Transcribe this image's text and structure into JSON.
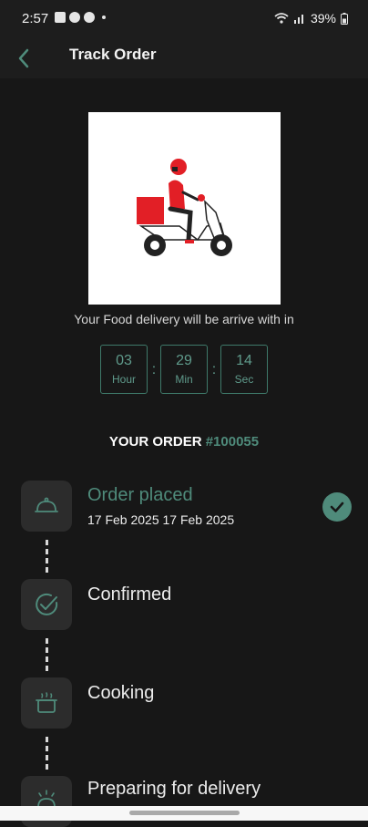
{
  "status_bar": {
    "time": "2:57",
    "battery": "39%"
  },
  "app_bar": {
    "title": "Track Order"
  },
  "delivery": {
    "message": "Your Food delivery will be arrive with in"
  },
  "countdown": [
    {
      "value": "03",
      "label": "Hour"
    },
    {
      "value": "29",
      "label": "Min"
    },
    {
      "value": "14",
      "label": "Sec"
    }
  ],
  "order": {
    "label": "YOUR ORDER",
    "id": "#100055"
  },
  "steps": [
    {
      "title": "Order placed",
      "date": "17 Feb 2025 17 Feb 2025",
      "done": true,
      "icon": "cloche-icon"
    },
    {
      "title": "Confirmed",
      "date": "",
      "done": false,
      "icon": "check-circle-icon"
    },
    {
      "title": "Cooking",
      "date": "",
      "done": false,
      "icon": "cooking-pot-icon"
    },
    {
      "title": "Preparing for delivery",
      "date": "",
      "done": false,
      "icon": "delivery-bell-icon"
    }
  ],
  "colors": {
    "accent": "#4f8b7b",
    "background": "#171717",
    "card": "#2c2c2c",
    "scooter_red": "#e21f26"
  }
}
